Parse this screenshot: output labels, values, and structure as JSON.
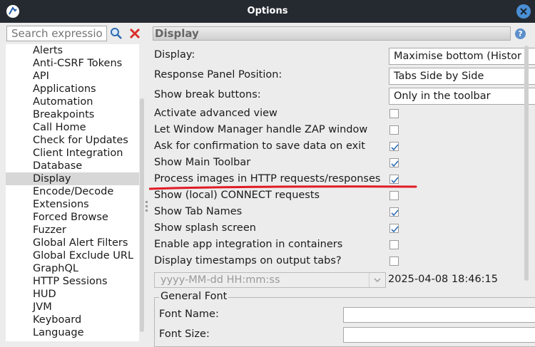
{
  "window": {
    "title": "Options"
  },
  "left": {
    "search_placeholder": "Search expressio",
    "tree_items": [
      "Alerts",
      "Anti-CSRF Tokens",
      "API",
      "Applications",
      "Automation",
      "Breakpoints",
      "Call Home",
      "Check for Updates",
      "Client Integration",
      "Database",
      "Display",
      "Encode/Decode",
      "Extensions",
      "Forced Browse",
      "Fuzzer",
      "Global Alert Filters",
      "Global Exclude URL",
      "GraphQL",
      "HTTP Sessions",
      "HUD",
      "JVM",
      "Keyboard",
      "Language"
    ],
    "selected_item": "Display"
  },
  "panel": {
    "title": "Display",
    "combos": [
      {
        "label": "Display:",
        "value": "Maximise bottom (Histor"
      },
      {
        "label": "Response Panel Position:",
        "value": "Tabs Side by Side"
      },
      {
        "label": "Show break buttons:",
        "value": "Only in the toolbar"
      }
    ],
    "checkboxes": [
      {
        "label": "Activate advanced view",
        "checked": false
      },
      {
        "label": "Let Window Manager handle ZAP window",
        "checked": false
      },
      {
        "label": "Ask for confirmation to save data on exit",
        "checked": true
      },
      {
        "label": "Show Main Toolbar",
        "checked": true
      },
      {
        "label": "Process images in HTTP requests/responses",
        "checked": true
      },
      {
        "label": "Show (local) CONNECT requests",
        "checked": false
      },
      {
        "label": "Show Tab Names",
        "checked": true
      },
      {
        "label": "Show splash screen",
        "checked": true
      },
      {
        "label": "Enable app integration in containers",
        "checked": false
      },
      {
        "label": "Display timestamps on output tabs?",
        "checked": false
      }
    ],
    "timestamp_format": "yyyy-MM-dd HH:mm:ss",
    "timestamp_preview": "2025-04-08 18:46:15",
    "general_font": {
      "legend": "General Font",
      "name_label": "Font Name:",
      "size_label": "Font Size:"
    }
  },
  "colors": {
    "titlebar": "#252a31",
    "accent": "#4a8fd4",
    "check": "#2d6db5",
    "highlight_underline": "#e01b24"
  },
  "icons": [
    "app-logo-icon",
    "close-icon",
    "search-icon",
    "clear-icon",
    "help-icon",
    "checkmark-icon",
    "chevron-down-icon"
  ]
}
